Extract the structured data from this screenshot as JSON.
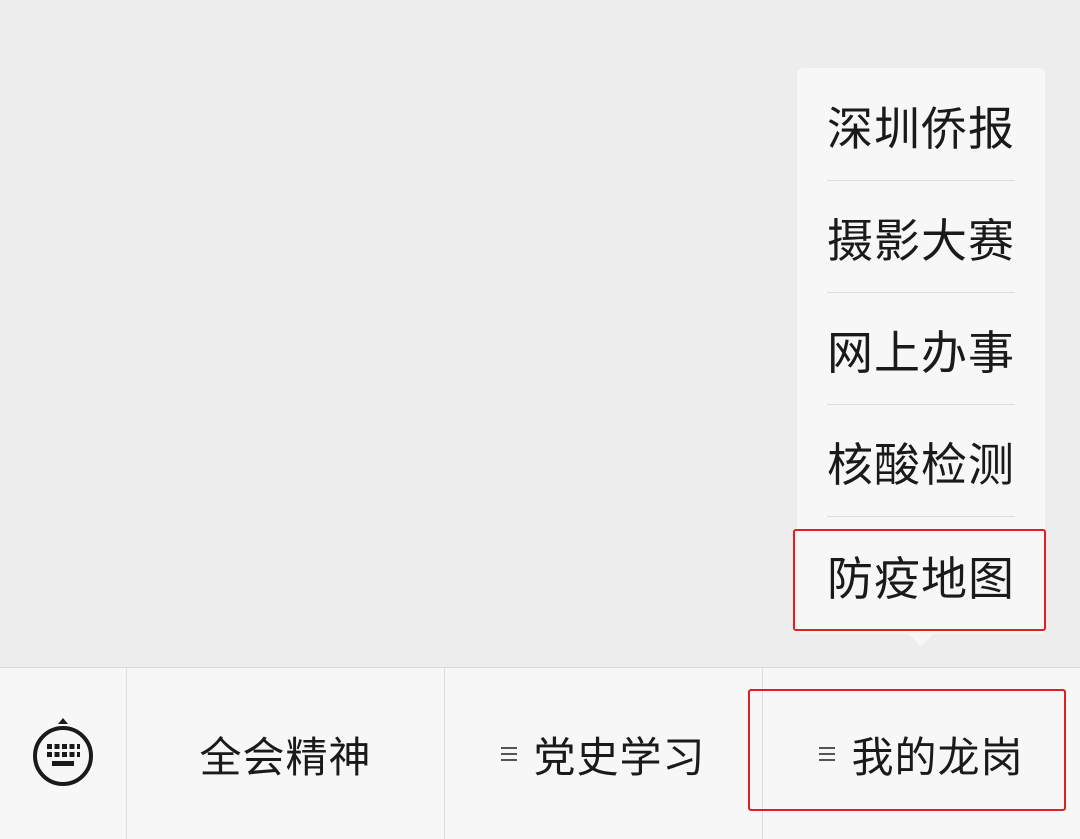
{
  "submenu": {
    "items": [
      {
        "label": "深圳侨报"
      },
      {
        "label": "摄影大赛"
      },
      {
        "label": "网上办事"
      },
      {
        "label": "核酸检测"
      },
      {
        "label": "防疫地图"
      }
    ]
  },
  "menubar": {
    "keyboard_icon": "keyboard-icon",
    "items": [
      {
        "label": "全会精神"
      },
      {
        "label": "党史学习"
      },
      {
        "label": "我的龙岗"
      }
    ]
  },
  "colors": {
    "background": "#ededed",
    "menu_bg": "#f7f7f7",
    "highlight": "#e02020",
    "text": "#1a1a1a"
  }
}
